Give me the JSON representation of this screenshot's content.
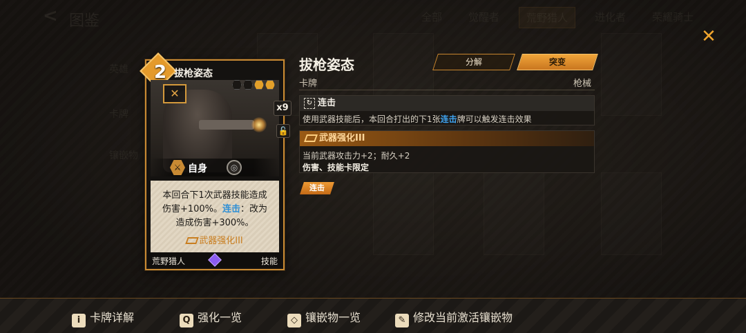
{
  "background": {
    "title": "图鉴",
    "tabs": [
      "全部",
      "觉醒者",
      "荒野猎人",
      "进化者",
      "荣耀骑士"
    ],
    "side_items": [
      "英雄",
      "卡牌",
      "镶嵌物"
    ]
  },
  "card": {
    "cost": "2",
    "name": "拔枪姿态",
    "target": "自身",
    "desc_line1": "本回合下1次武器技能造成",
    "desc_line2_pre": "伤害+100%。",
    "desc_line2_kw": "连击",
    "desc_line2_post": "：改为",
    "desc_line3": "造成伤害+300%。",
    "desc_tag": "武器强化III",
    "class": "荒野猎人",
    "kind": "技能",
    "count": "x9",
    "energy_slots": 4,
    "energy_filled": 2
  },
  "detail": {
    "title": "拔枪姿态",
    "type": "卡牌",
    "category": "枪械",
    "btn_split": "分解",
    "btn_mutate": "突变",
    "kw1_title": "连击",
    "kw1_body_pre": "使用武器技能后，本回合打出的下1张",
    "kw1_body_kw": "连击",
    "kw1_body_post": "牌可以触发连击效果",
    "kw2_title": "武器强化III",
    "kw2_line1": "当前武器攻击力+2；耐久+2",
    "kw2_line2": "伤害、技能卡限定",
    "tag": "连击"
  },
  "bottom_bar": {
    "items": [
      {
        "icon": "i",
        "label": "卡牌详解"
      },
      {
        "icon": "Q",
        "label": "强化一览"
      },
      {
        "icon": "◇",
        "label": "镶嵌物一览"
      },
      {
        "icon": "✎",
        "label": "修改当前激活镶嵌物"
      }
    ]
  },
  "colors": {
    "accent": "#e49a2b",
    "keyword": "#3fa3ef",
    "gem": "#8b5cf0"
  }
}
